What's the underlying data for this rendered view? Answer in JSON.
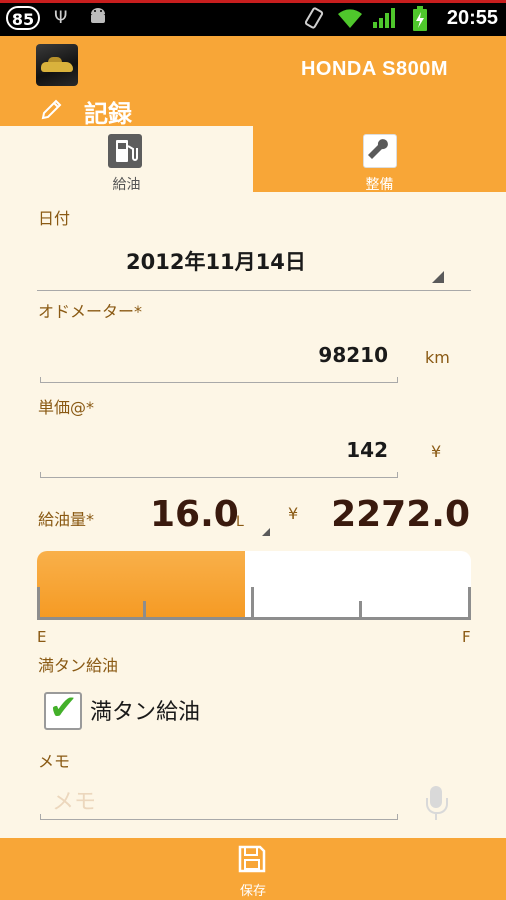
{
  "status_bar": {
    "notification_count": "85",
    "time": "20:55",
    "icons": [
      "usb-icon",
      "android-icon",
      "rotate-icon",
      "wifi-icon",
      "signal-icon",
      "battery-charging-icon"
    ]
  },
  "action_bar": {
    "vehicle_name": "HONDA S800M",
    "section_title": "記録"
  },
  "tabs": [
    {
      "label": "給油",
      "icon": "fuel-pump-icon",
      "active": true
    },
    {
      "label": "整備",
      "icon": "wrench-icon",
      "active": false
    }
  ],
  "form": {
    "date": {
      "label": "日付",
      "value": "2012年11月14日"
    },
    "odometer": {
      "label": "オドメーター*",
      "value": "98210",
      "unit": "km"
    },
    "unit_price": {
      "label": "単価@*",
      "value": "142",
      "unit": "¥"
    },
    "fuel_amount": {
      "label": "給油量*",
      "value": "16.0",
      "unit": "L",
      "currency": "¥",
      "total": "2272.0"
    },
    "gauge": {
      "fill_fraction": 0.48,
      "empty_label": "E",
      "full_label": "F"
    },
    "full_tank": {
      "label": "満タン給油",
      "checkbox_label": "満タン給油",
      "checked": true
    },
    "memo": {
      "label": "メモ",
      "placeholder": "メモ"
    }
  },
  "bottom_bar": {
    "save_label": "保存"
  },
  "colors": {
    "accent": "#f8a637",
    "label": "#8a5a14",
    "background": "#fdf6e6",
    "check": "#43b02a"
  }
}
